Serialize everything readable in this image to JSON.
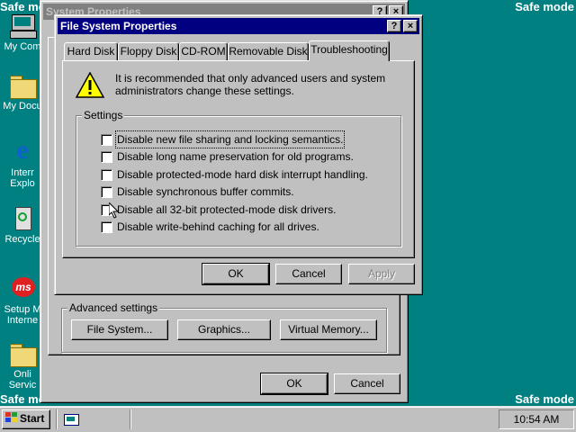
{
  "safe_mode_label": "Safe mode",
  "desktop_icons": [
    {
      "label": "My Computer",
      "icon": "computer-icon"
    },
    {
      "label": "My Documents",
      "icon": "folder-icon"
    },
    {
      "label": "Internet Explorer",
      "icon": "ie-icon"
    },
    {
      "label": "Recycle Bin",
      "icon": "recycle-bin-icon"
    },
    {
      "label": "Setup MSN Internet Access",
      "icon": "msn-icon"
    },
    {
      "label": "Online Services",
      "icon": "folder-icon"
    }
  ],
  "desktop_icons_visible": [
    "My Com",
    "My Docu",
    "Interr",
    "Explo",
    "Recycle",
    "Setup M",
    "Interne",
    "Onli",
    "Servic"
  ],
  "system_properties": {
    "title": "System Properties",
    "advanced_group": "Advanced settings",
    "buttons": {
      "file_system": "File System...",
      "graphics": "Graphics...",
      "virtual_memory": "Virtual Memory..."
    },
    "ok": "OK",
    "cancel": "Cancel"
  },
  "file_system_properties": {
    "title": "File System Properties",
    "help_glyph": "?",
    "close_glyph": "×",
    "tabs": [
      "Hard Disk",
      "Floppy Disk",
      "CD-ROM",
      "Removable Disk",
      "Troubleshooting"
    ],
    "selected_tab": "Troubleshooting",
    "warning_text_line1": "It is recommended that only advanced users and system",
    "warning_text_line2": "administrators change these settings.",
    "settings_group": "Settings",
    "options": [
      {
        "label": "Disable new file sharing and locking semantics.",
        "checked": false
      },
      {
        "label": "Disable long name preservation for old programs.",
        "checked": false
      },
      {
        "label": "Disable protected-mode hard disk interrupt handling.",
        "checked": false
      },
      {
        "label": "Disable synchronous buffer commits.",
        "checked": false
      },
      {
        "label": "Disable all 32-bit protected-mode disk drivers.",
        "checked": false
      },
      {
        "label": "Disable write-behind caching for all drives.",
        "checked": false
      }
    ],
    "ok": "OK",
    "cancel": "Cancel",
    "apply": "Apply"
  },
  "taskbar": {
    "start_label": "Start",
    "clock": "10:54 AM"
  },
  "colors": {
    "desktop": "#008080",
    "title_active": "#000080",
    "title_inactive": "#808080",
    "face": "#c0c0c0"
  }
}
